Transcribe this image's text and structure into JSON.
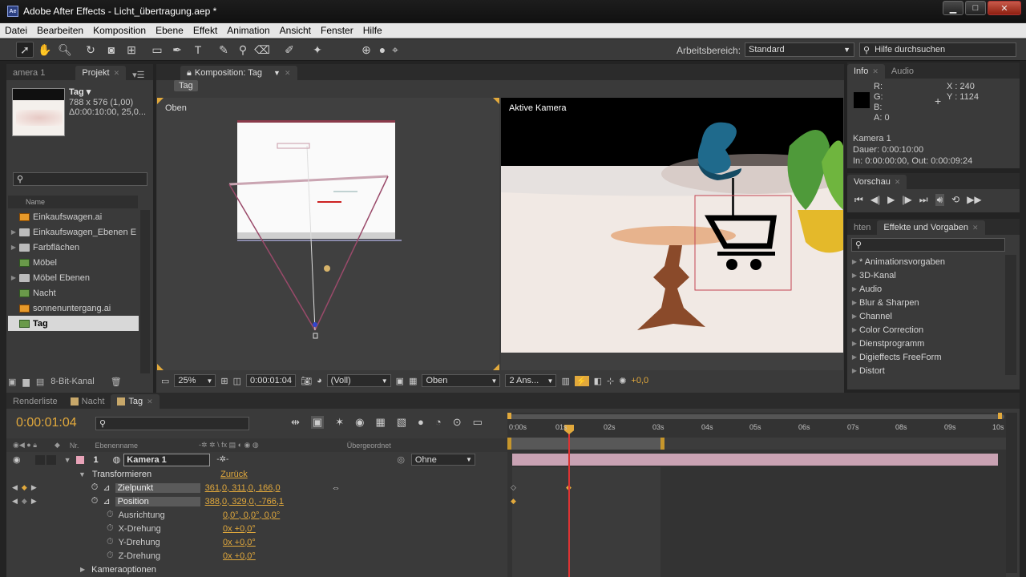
{
  "window": {
    "title": "Adobe After Effects - Licht_übertragung.aep *",
    "app_badge": "Ae",
    "minimize": "▁",
    "maximize": "□",
    "close": "✕"
  },
  "menu": [
    "Datei",
    "Bearbeiten",
    "Komposition",
    "Ebene",
    "Effekt",
    "Animation",
    "Ansicht",
    "Fenster",
    "Hilfe"
  ],
  "toolbar": {
    "workspace_label": "Arbeitsbereich:",
    "workspace_value": "Standard",
    "help_placeholder": "Hilfe durchsuchen"
  },
  "project": {
    "tab_left": "amera 1",
    "tab_label": "Projekt",
    "comp_name": "Tag ▾",
    "comp_size": "788 x 576 (1,00)",
    "comp_duration": "Δ0:00:10:00, 25,0...",
    "col_name": "Name",
    "items": [
      {
        "name": "Einkaufswagen.ai",
        "type": "ai",
        "expandable": false
      },
      {
        "name": "Einkaufswagen_Ebenen E",
        "type": "folder",
        "expandable": true
      },
      {
        "name": "Farbflächen",
        "type": "folder",
        "expandable": true
      },
      {
        "name": "Möbel",
        "type": "comp",
        "expandable": false
      },
      {
        "name": "Möbel Ebenen",
        "type": "folder",
        "expandable": true
      },
      {
        "name": "Nacht",
        "type": "comp",
        "expandable": false
      },
      {
        "name": "sonnenuntergang.ai",
        "type": "ai",
        "expandable": false
      },
      {
        "name": "Tag",
        "type": "comp",
        "expandable": false,
        "selected": true
      }
    ],
    "bit_depth": "8-Bit-Kanal"
  },
  "composition": {
    "tab_label": "Komposition: Tag",
    "sub_tab": "Tag",
    "left_view_label": "Oben",
    "right_view_label": "Aktive Kamera",
    "zoom": "25%",
    "timecode": "0:00:01:04",
    "resolution": "(Voll)",
    "view": "Oben",
    "views_layout": "2 Ans...",
    "exposure": "+0,0"
  },
  "info": {
    "tab": "Info",
    "tab2": "Audio",
    "r": "R:",
    "g": "G:",
    "b": "B:",
    "a": "A:  0",
    "x": "X : 240",
    "y": "Y : 1124",
    "layer": "Kamera 1",
    "duration": "Dauer: 0:00:10:00",
    "inout": "In: 0:00:00:00, Out: 0:00:09:24"
  },
  "preview": {
    "tab": "Vorschau"
  },
  "effects": {
    "tab_left": "hten",
    "tab": "Effekte und Vorgaben",
    "items": [
      "* Animationsvorgaben",
      "3D-Kanal",
      "Audio",
      "Blur & Sharpen",
      "Channel",
      "Color Correction",
      "Dienstprogramm",
      "Digieffects FreeForm",
      "Distort"
    ]
  },
  "timeline": {
    "tabs": [
      "Renderliste",
      "Nacht",
      "Tag"
    ],
    "timecode": "0:00:01:04",
    "col_nr": "Nr.",
    "col_layername": "Ebenenname",
    "col_switches": "-✲ ✲ \\ fx ▤ ◐ ◉ ◍",
    "col_parent": "Übergeordnet",
    "layer_num": "1",
    "layer_name": "Kamera 1",
    "parent": "Ohne",
    "transform_label": "Transformieren",
    "reset_label": "Zurück",
    "properties": [
      {
        "name": "Zielpunkt",
        "value": "361,0, 311,0, 166,0",
        "selected": true
      },
      {
        "name": "Position",
        "value": "388,0, 329,0, -766,1",
        "selected": true
      },
      {
        "name": "Ausrichtung",
        "value": "0,0°, 0,0°, 0,0°",
        "selected": false
      },
      {
        "name": "X-Drehung",
        "value": "0x +0,0°",
        "selected": false
      },
      {
        "name": "Y-Drehung",
        "value": "0x +0,0°",
        "selected": false
      },
      {
        "name": "Z-Drehung",
        "value": "0x +0,0°",
        "selected": false
      }
    ],
    "camera_options": "Kameraoptionen",
    "ruler": [
      "0:00s",
      "01s",
      "02s",
      "03s",
      "04s",
      "05s",
      "06s",
      "07s",
      "08s",
      "09s",
      "10s"
    ]
  },
  "colors": {
    "accent_orange": "#e2a93c",
    "layer_bar_pink": "#c9a2b3",
    "current_time_red": "#d33",
    "panel_bg": "#3a3a3a"
  }
}
